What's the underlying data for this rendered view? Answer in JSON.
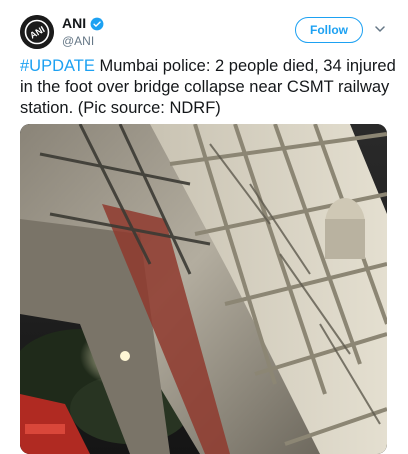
{
  "tweet": {
    "author_name": "ANI",
    "author_handle": "@ANI",
    "follow_label": "Follow",
    "hashtag": "#UPDATE",
    "body_text": " Mumbai police: 2 people died, 34 injured in the foot over bridge collapse near CSMT railway station. (Pic source: NDRF)",
    "avatar_icon": "ani-logo-avatar",
    "verified_icon": "verified-badge-icon",
    "menu_icon": "chevron-down-icon",
    "accent_color": "#1da1f2"
  }
}
